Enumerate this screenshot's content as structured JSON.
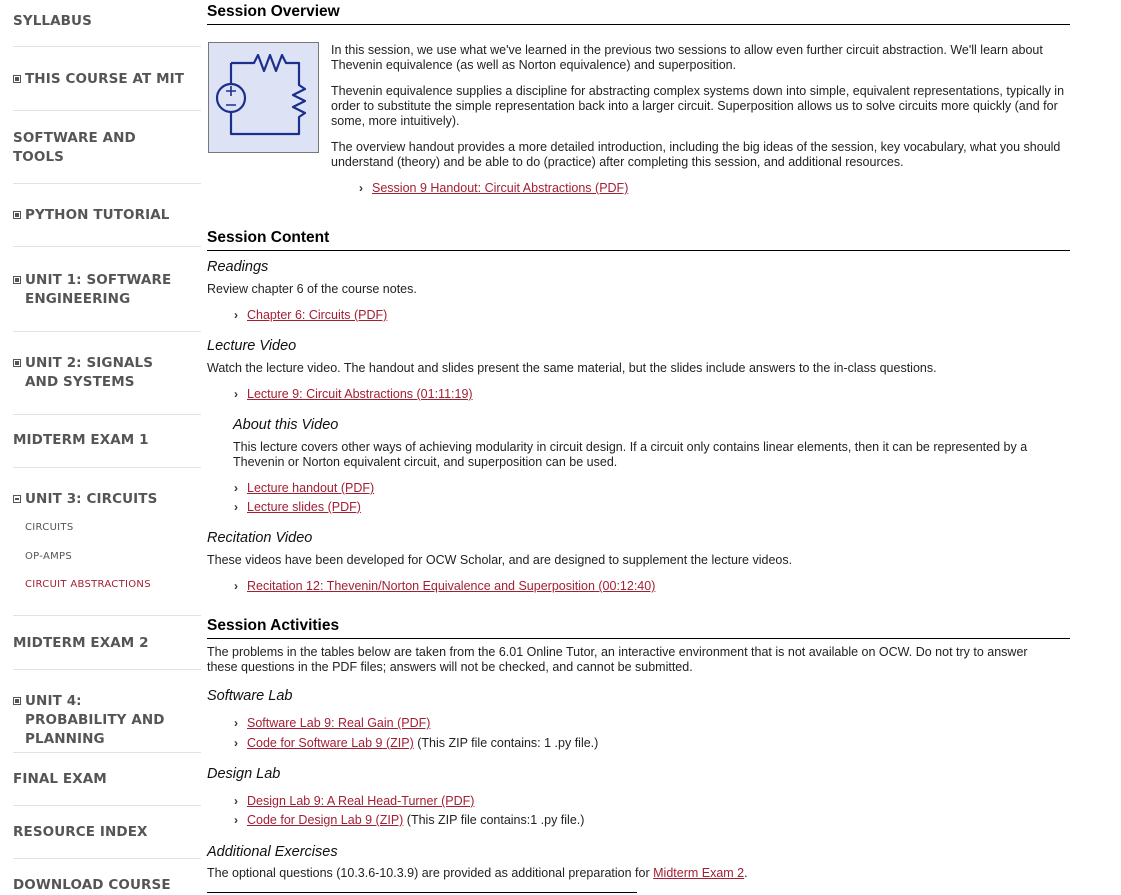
{
  "sidebar": {
    "items": [
      {
        "label": "SYLLABUS"
      },
      {
        "label": "THIS COURSE AT MIT"
      },
      {
        "label": "SOFTWARE AND TOOLS"
      },
      {
        "label": "PYTHON TUTORIAL"
      },
      {
        "label": "UNIT 1: SOFTWARE ENGINEERING"
      },
      {
        "label": "UNIT 2: SIGNALS AND SYSTEMS"
      },
      {
        "label": "MIDTERM EXAM 1"
      },
      {
        "label": "UNIT 3: CIRCUITS"
      },
      {
        "label": "MIDTERM EXAM 2"
      },
      {
        "label": "UNIT 4: PROBABILITY AND PLANNING"
      },
      {
        "label": "FINAL EXAM"
      },
      {
        "label": "RESOURCE INDEX"
      },
      {
        "label": "DOWNLOAD COURSE"
      }
    ],
    "unit3_subitems": [
      {
        "label": "CIRCUITS"
      },
      {
        "label": "OP-AMPS"
      },
      {
        "label": "CIRCUIT ABSTRACTIONS"
      }
    ]
  },
  "overview": {
    "heading": "Session Overview",
    "p1": "In this session, we use what we've learned in the previous two sessions to allow even further circuit abstraction. We'll learn about Thevenin equivalence (as well as Norton equivalence) and superposition.",
    "p2": "Thevenin equivalence supplies a discipline for abstracting complex systems down into simple, equivalent representations, typically in order to substitute the simple representation back into a larger circuit. Superposition allows us to solve circuits more quickly (and for some, more intuitively).",
    "p3": "The overview handout provides a more detailed introduction, including the big ideas of the session, key vocabulary, what you should understand (theory) and be able to do (practice) after completing this session, and additional resources.",
    "handout_link": "Session 9 Handout: Circuit Abstractions (PDF)"
  },
  "content": {
    "heading": "Session Content",
    "readings_title": "Readings",
    "readings_text": "Review chapter 6 of the course notes.",
    "readings_link": "Chapter 6: Circuits (PDF)",
    "lecture_title": "Lecture Video",
    "lecture_text": "Watch the lecture video. The handout and slides present the same material, but the slides include answers to the in-class questions.",
    "lecture_link": "Lecture 9: Circuit Abstractions (01:11:19)",
    "about_title": "About this Video",
    "about_text": "This lecture covers other ways of achieving modularity in circuit design. If a circuit only contains linear elements, then it can be represented by a Thevenin or Norton equivalent circuit, and superposition can be used.",
    "handout_link": "Lecture handout (PDF)",
    "slides_link": "Lecture slides (PDF)",
    "recitation_title": "Recitation Video",
    "recitation_text": "These videos have been developed for OCW Scholar, and are designed to supplement the lecture videos.",
    "recitation_link": "Recitation 12: Thevenin/Norton Equivalence and Superposition (00:12:40)"
  },
  "activities": {
    "heading": "Session Activities",
    "intro": "The problems in the tables below are taken from the 6.01 Online Tutor, an interactive environment that is not available on OCW. Do not try to answer these questions in the PDF files; answers will not be checked, and cannot be submitted.",
    "software_title": "Software Lab",
    "software_link": "Software Lab 9: Real Gain (PDF)",
    "software_code_link": "Code for Software Lab 9 (ZIP)",
    "software_code_note": " (This ZIP file contains: 1 .py file.)",
    "design_title": "Design Lab",
    "design_link": "Design Lab 9: A Real Head-Turner (PDF)",
    "design_code_link": "Code for Design Lab 9 (ZIP)",
    "design_code_note": " (This ZIP file contains:1 .py file.)",
    "additional_title": "Additional Exercises",
    "additional_text": "The optional questions (10.3.6-10.3.9) are provided as additional preparation for ",
    "additional_link": "Midterm Exam 2",
    "additional_end": "."
  },
  "colors": {
    "link": "#a31f34",
    "nav_text": "#555555",
    "diagram_bg": "#dde3f5",
    "diagram_stroke": "#1c2f8c"
  },
  "icons": {
    "chevron": "chevron-right-icon",
    "expand": "plus-square-icon",
    "collapse": "minus-square-icon"
  }
}
